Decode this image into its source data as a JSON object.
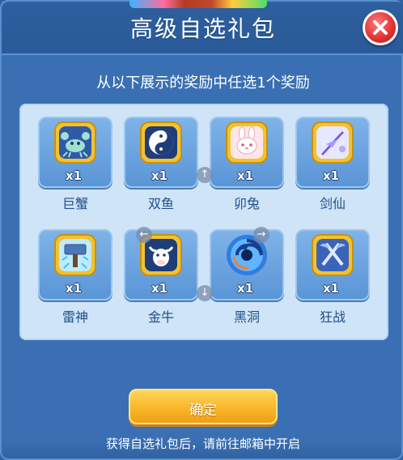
{
  "header": {
    "title": "高级自选礼包",
    "close_icon": "close-icon"
  },
  "instructions": "从以下展示的奖励中任选1个奖励",
  "rewards": [
    {
      "name": "巨蟹",
      "count": "x1",
      "icon": "crab-icon"
    },
    {
      "name": "双鱼",
      "count": "x1",
      "icon": "pisces-icon"
    },
    {
      "name": "卯兔",
      "count": "x1",
      "icon": "rabbit-icon"
    },
    {
      "name": "剑仙",
      "count": "x1",
      "icon": "sword-immortal-icon"
    },
    {
      "name": "雷神",
      "count": "x1",
      "icon": "thunder-hammer-icon"
    },
    {
      "name": "金牛",
      "count": "x1",
      "icon": "bull-icon"
    },
    {
      "name": "黑洞",
      "count": "x1",
      "icon": "black-hole-icon"
    },
    {
      "name": "狂战",
      "count": "x1",
      "icon": "berserker-axes-icon"
    }
  ],
  "confirm_button": "确定",
  "footer_note": "获得自选礼包后，请前往邮箱中开启",
  "colors": {
    "accent": "#f8b72a",
    "panel": "#3a70b3",
    "grid_bg": "#cfe4f7",
    "close": "#e23030"
  }
}
